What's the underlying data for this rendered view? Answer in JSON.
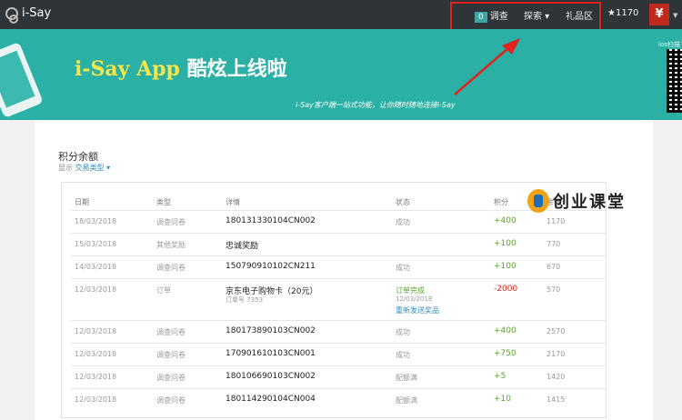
{
  "header": {
    "logo_text": "i-Say",
    "badge_count": "0",
    "nav": [
      "调查",
      "探索 ▾",
      "礼品区"
    ],
    "points": "★1170",
    "avatar_text": "¥"
  },
  "banner": {
    "title_brand": "i-Say App",
    "title_cn": "酷炫上线啦",
    "subtitle": "i-Say客户端一站式功能，让你随时随地连接i-Say",
    "ios_label": "ios扫描"
  },
  "section": {
    "title": "积分余额",
    "filter_label": "显示",
    "filter_value": "交易类型 ▾"
  },
  "table": {
    "headers": [
      "日期",
      "类型",
      "详情",
      "状态",
      "积分",
      "余额"
    ],
    "rows": [
      {
        "date": "18/03/2018",
        "type": "调查问卷",
        "detail": "180131330104CN002",
        "status": "成功",
        "points": "+400",
        "balance": "1170"
      },
      {
        "date": "15/03/2018",
        "type": "其他奖励",
        "detail": "忠诚奖励",
        "status": "",
        "points": "+100",
        "balance": "770"
      },
      {
        "date": "14/03/2018",
        "type": "调查问卷",
        "detail": "150790910102CN211",
        "status": "成功",
        "points": "+100",
        "balance": "670"
      },
      {
        "date": "12/03/2018",
        "type": "订单",
        "detail": "京东电子购物卡（20元）",
        "detail_sub": "订单号 7353",
        "status": "订单完成",
        "status_sub": "12/03/2018",
        "status_link": "重新发送奖品",
        "points": "-2000",
        "balance": "570"
      },
      {
        "date": "12/03/2018",
        "type": "调查问卷",
        "detail": "180173890103CN002",
        "status": "成功",
        "points": "+400",
        "balance": "2570"
      },
      {
        "date": "12/03/2018",
        "type": "调查问卷",
        "detail": "170901610103CN001",
        "status": "成功",
        "points": "+750",
        "balance": "2170"
      },
      {
        "date": "12/03/2018",
        "type": "调查问卷",
        "detail": "180106690103CN002",
        "status": "配额满",
        "points": "+5",
        "balance": "1420"
      },
      {
        "date": "12/03/2018",
        "type": "调查问卷",
        "detail": "180114290104CN004",
        "status": "配额满",
        "points": "+10",
        "balance": "1415"
      }
    ]
  },
  "watermark": {
    "text": "创业课堂"
  },
  "colors": {
    "topbar": "#2e3438",
    "banner": "#2ab0a5",
    "highlight": "#e0231c",
    "positive": "#5aa52d",
    "negative": "#e0231c",
    "link": "#2b8fc8"
  }
}
